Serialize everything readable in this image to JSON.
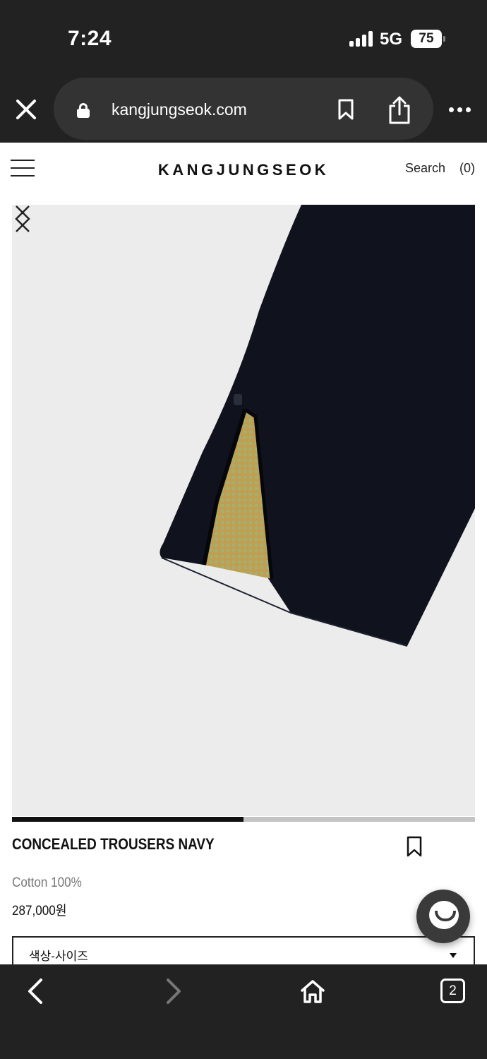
{
  "status_bar": {
    "time": "7:24",
    "network": "5G",
    "battery": "75"
  },
  "browser": {
    "url": "kangjungseok.com",
    "tab_count": "2"
  },
  "site": {
    "logo": "KANGJUNGSEOK",
    "search_label": "Search",
    "cart_label": "(0)"
  },
  "product": {
    "name": "CONCEALED TROUSERS NAVY",
    "material": "Cotton 100%",
    "price": "287,000원",
    "option_label": "색상-사이즈",
    "gallery_progress": 0.5
  },
  "icons": {
    "close": "close-icon",
    "lock": "lock-icon",
    "bookmark": "bookmark-icon",
    "share": "share-icon",
    "more": "more-icon",
    "menu": "hamburger-icon",
    "chat": "chat-icon",
    "back": "chevron-left-icon",
    "forward": "chevron-right-icon",
    "home": "home-icon"
  },
  "colors": {
    "browser_chrome": "#222222",
    "image_bg": "#ececec",
    "trousers": "#10131d"
  }
}
